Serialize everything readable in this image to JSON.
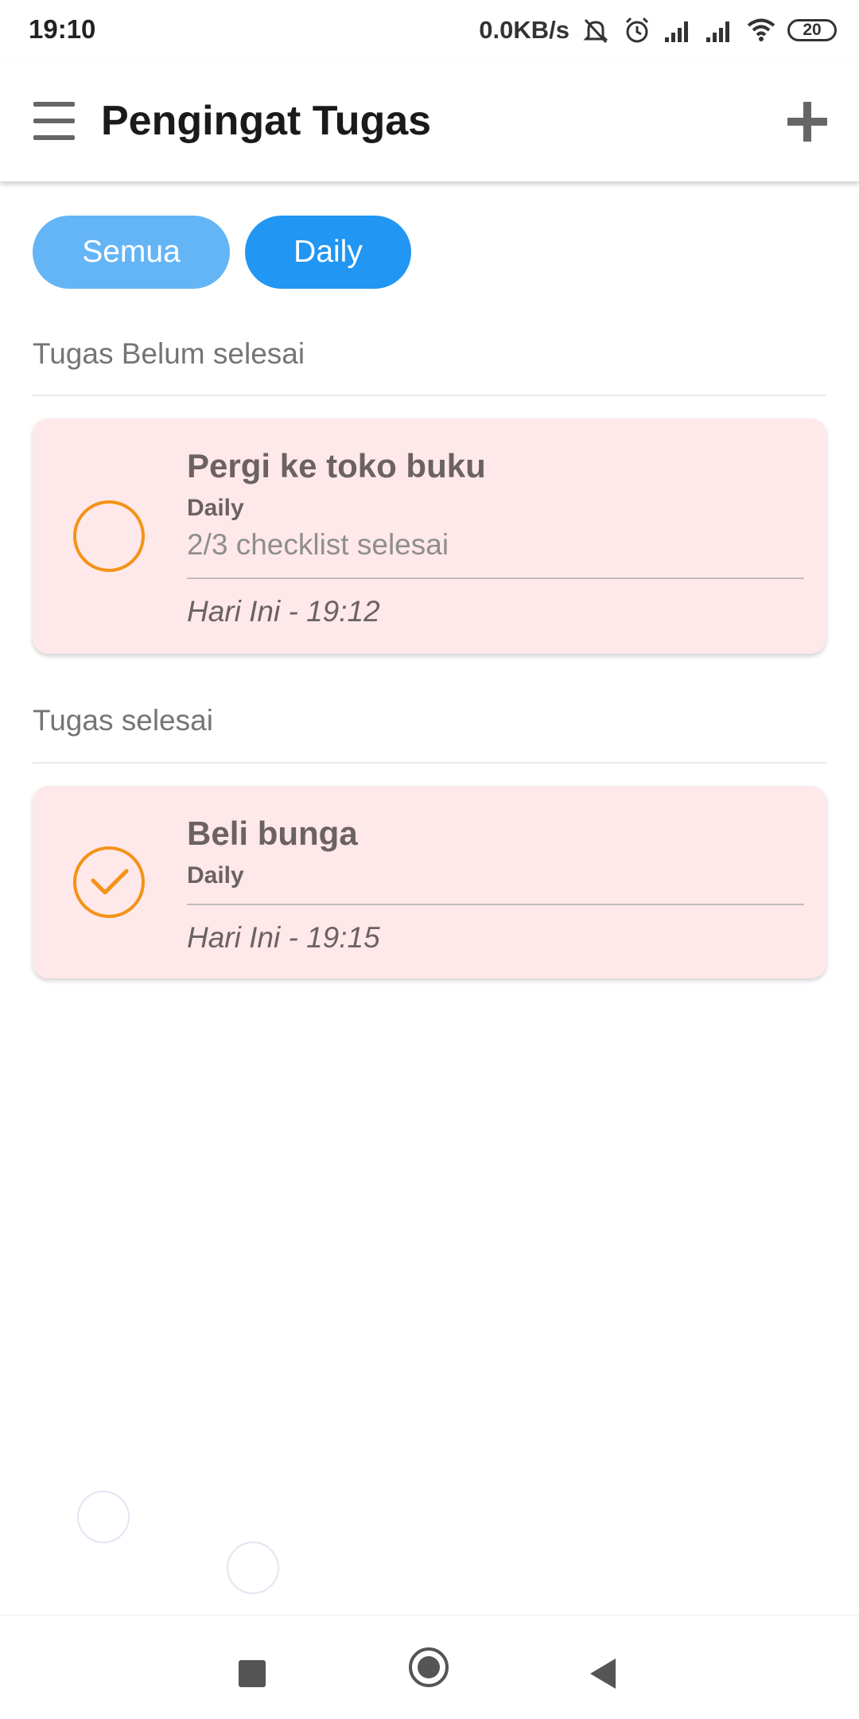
{
  "status_bar": {
    "time": "19:10",
    "net_speed": "0.0KB/s",
    "battery": "20",
    "icons": [
      "muted-bell-icon",
      "alarm-icon",
      "signal-icon",
      "signal-icon",
      "wifi-icon",
      "battery-icon"
    ]
  },
  "app_bar": {
    "title": "Pengingat Tugas",
    "menu_icon": "hamburger-menu-icon",
    "add_icon": "plus-icon"
  },
  "filters": {
    "all_label": "Semua",
    "daily_label": "Daily",
    "selected": "Daily"
  },
  "sections": {
    "pending_title": "Tugas Belum selesai",
    "done_title": "Tugas selesai"
  },
  "tasks_pending": [
    {
      "title": "Pergi ke toko buku",
      "category": "Daily",
      "checklist": "2/3 checklist selesai",
      "time": "Hari Ini - 19:12",
      "completed": false
    }
  ],
  "tasks_done": [
    {
      "title": "Beli bunga",
      "category": "Daily",
      "time": "Hari Ini - 19:15",
      "completed": true
    }
  ],
  "colors": {
    "chip_all": "#64b5f6",
    "chip_daily": "#2196f3",
    "card_bg": "#ffe8ea",
    "status_orange": "#f39317"
  },
  "nav_bar": {
    "icons": [
      "recent-apps-icon",
      "home-icon",
      "back-icon"
    ]
  }
}
